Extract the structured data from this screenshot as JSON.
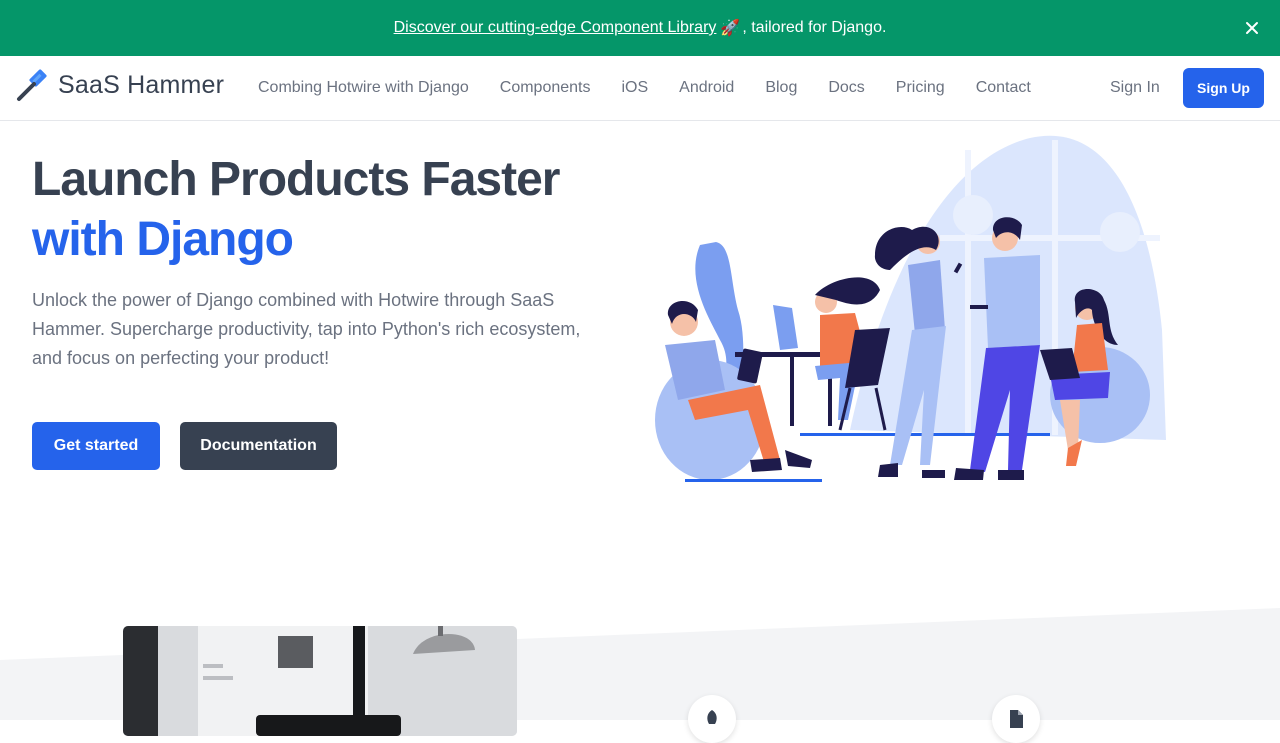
{
  "banner": {
    "link_text": "Discover our cutting-edge Component Library",
    "rocket": "🚀",
    "suffix": ", tailored for Django.",
    "close_icon": "close-icon"
  },
  "nav": {
    "logo_text": "SaaS Hammer",
    "logo_icon": "hammer-icon",
    "links": [
      "Combing Hotwire with Django",
      "Components",
      "iOS",
      "Android",
      "Blog",
      "Docs",
      "Pricing",
      "Contact"
    ],
    "sign_in": "Sign In",
    "sign_up": "Sign Up"
  },
  "hero": {
    "title_line1": "Launch Products Faster",
    "title_line2": "with Django",
    "description": "Unlock the power of Django combined with Hotwire through SaaS Hammer. Supercharge productivity, tap into Python's rich ecosystem, and focus on perfecting your product!",
    "primary_button": "Get started",
    "secondary_button": "Documentation"
  },
  "features": {
    "icons": [
      "rocket-icon",
      "document-icon"
    ]
  },
  "colors": {
    "banner": "#059669",
    "primary": "#2563eb",
    "dark": "#374151",
    "muted": "#6b7280"
  }
}
